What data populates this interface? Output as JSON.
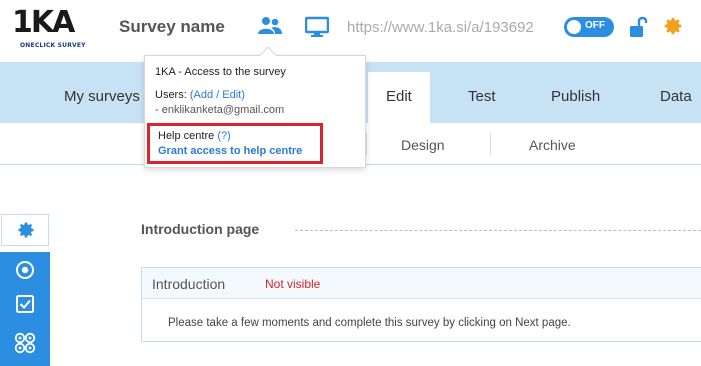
{
  "header": {
    "logo_text": "1KA",
    "logo_sub": "ONECLICK SURVEY",
    "survey_name": "Survey name",
    "url": "https://www.1ka.si/a/193692",
    "toggle_label": "OFF"
  },
  "nav": {
    "items": [
      "My surveys",
      "Edit",
      "Test",
      "Publish",
      "Data"
    ],
    "active": "Edit"
  },
  "subtabs": [
    "Design",
    "Archive"
  ],
  "popup": {
    "title": "1KA - Access to the survey",
    "users_label": "Users:",
    "users_open": "(",
    "users_link": "Add / Edit",
    "users_close": ")",
    "user_email": "- enklikanketa@gmail.com",
    "help_title": "Help centre",
    "help_q": "(?)",
    "help_link": "Grant access to help centre"
  },
  "content": {
    "section_heading": "Introduction page",
    "card_title": "Introduction",
    "card_status": "Not visible",
    "card_text": "Please take a few moments and complete this survey by clicking on Next page."
  },
  "colors": {
    "accent": "#2b8ee0",
    "nav_band": "#c8e2f5",
    "highlight": "#d9232d"
  },
  "icons": [
    "users-icon",
    "monitor-icon",
    "unlock-icon",
    "gear-icon",
    "target-icon",
    "checkbox-icon",
    "grid-circles-icon"
  ]
}
